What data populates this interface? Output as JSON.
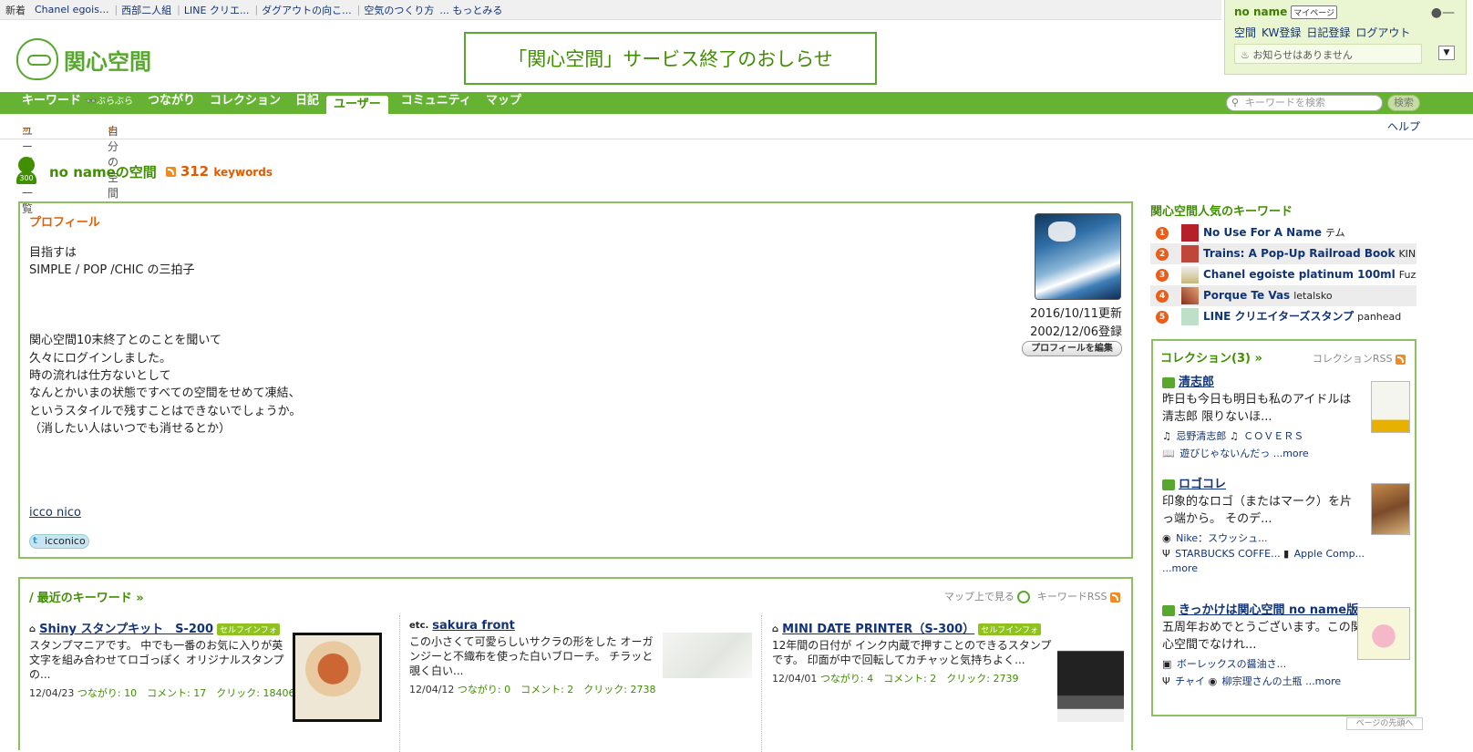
{
  "topbar": {
    "label": "新着",
    "items": [
      "Chanel egois...",
      "西部二人組",
      "LINE クリエ...",
      "ダグアウトの向こ...",
      "空気のつくり方"
    ],
    "more": "... もっとみる"
  },
  "user_panel": {
    "name": "no name",
    "mypage": "マイページ",
    "links": [
      "空間",
      "KW登録",
      "日記登録",
      "ログアウト"
    ],
    "notice": "お知らせはありません"
  },
  "logo": {
    "text": "関心空間"
  },
  "announcement": "「関心空間」サービス終了のおしらせ",
  "nav": {
    "items": [
      "キーワード",
      "ぶらぶら",
      "つながり",
      "コレクション",
      "日記",
      "ユーザー",
      "コミュニティ",
      "マップ"
    ],
    "active": "ユーザー",
    "search_placeholder": "キーワードを検索",
    "search_button": "検索"
  },
  "subnav": {
    "items": [
      "ユーザー一覧",
      "自分の空間"
    ],
    "arrow": "»",
    "help": "ヘルプ"
  },
  "space": {
    "badge": "300",
    "title": "no nameの空間",
    "keyword_count": "312",
    "keyword_unit": "keywords"
  },
  "profile": {
    "heading": "プロフィール",
    "text": "目指すは\nSIMPLE / POP /CHIC の三拍子\n\n\n\n関心空間10末終了とのことを聞いて\n久々にログインしました。\n時の流れは仕方ないとして\nなんとかいまの状態ですべての空間をせめて凍結、\nというスタイルで残すことはできないでしょうか。\n（消したい人はいつでも消せるとか）",
    "link": "icco nico",
    "twitter": "icconico",
    "updated": "2016/10/11更新",
    "registered": "2002/12/06登録",
    "edit_button": "プロフィールを編集"
  },
  "recent": {
    "heading": "最近のキーワード »",
    "map_link": "マップ上で見る",
    "rss": "キーワードRSS",
    "keywords": [
      {
        "title": "Shiny スタンプキット　S-200",
        "tag": "セルフインフォ",
        "desc": "スタンプマニアです。 中でも一番のお気に入りが英文字を組み合わせてロゴっぽく オリジナルスタンプの...",
        "date": "12/04/23",
        "meta": "つながり: 10　コメント: 17　クリック: 18406"
      },
      {
        "icon": "etc.",
        "title": "sakura front",
        "desc": "この小さくて可愛らしいサクラの形をした オーガンジーと不織布を使った白いブローチ。 チラッと覗く白い...",
        "date": "12/04/12",
        "meta": "つながり: 0　コメント: 2　クリック: 2738"
      },
      {
        "title": "MINI DATE PRINTER（S-300）",
        "tag": "セルフインフォ",
        "desc": "12年間の日付が インク内蔵で押すことのできるスタンプです。 印面が中で回転してカチャッと気持ちよく...",
        "date": "12/04/01",
        "meta": "つながり: 4　コメント: 2　クリック: 2739"
      }
    ]
  },
  "popular": {
    "heading": "関心空間人気のキーワード",
    "items": [
      {
        "rank": "1",
        "title": "No Use For A Name",
        "user": "テム"
      },
      {
        "rank": "2",
        "title": "Trains: A Pop-Up Railroad Book",
        "user": "KINSENK"
      },
      {
        "rank": "3",
        "title": "Chanel egoiste platinum 100ml",
        "user": "Fuzzio"
      },
      {
        "rank": "4",
        "title": "Porque Te Vas",
        "user": "letalsko"
      },
      {
        "rank": "5",
        "title": "LINE クリエイターズスタンプ",
        "user": "panhead"
      }
    ]
  },
  "collection": {
    "heading": "コレクション(3) »",
    "rss": "コレクションRSS",
    "items": [
      {
        "title": "清志郎",
        "desc": "昨日も今日も明日も私のアイドルは清志郎 限りないほ...",
        "links": [
          "忌野清志郎",
          "ＣＯＶＥＲＳ",
          "遊びじゃないんだっ"
        ],
        "more": "...more"
      },
      {
        "title": "ロゴコレ",
        "desc": "印象的なロゴ（またはマーク）を片っ端から。 そのデ...",
        "links": [
          "Nike：スウッシュ...",
          "STARBUCKS COFFE...",
          "Apple Comp..."
        ],
        "more": "...more"
      },
      {
        "title": "きっかけは関心空間 no name版",
        "desc": "五周年おめでとうございます。この関心空間でなけれ...",
        "links": [
          "ボーレックスの醤油さ...",
          "チャイ",
          "柳宗理さんの土瓶"
        ],
        "more": "...more"
      }
    ]
  },
  "pagetop": "ページの先頭へ",
  "colors": {
    "brand_green": "#66b334",
    "accent_orange": "#ea5d1a",
    "link_blue": "#113377"
  }
}
